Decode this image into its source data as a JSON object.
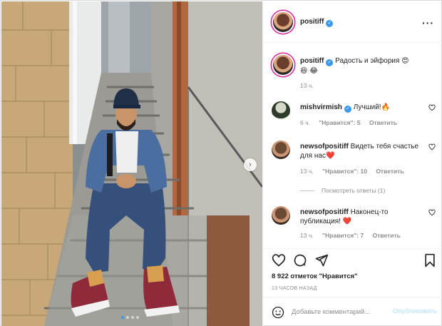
{
  "post": {
    "author": "positiff",
    "verified": true,
    "more_icon": "more-icon"
  },
  "caption": {
    "username": "positiff",
    "text": "Радость и эйфория",
    "emojis": [
      "😍",
      "😆",
      "😂"
    ],
    "time": "13 ч."
  },
  "comments": [
    {
      "username": "mishvirmish",
      "verified": true,
      "text": "Лучший!",
      "emoji": "🔥",
      "time": "6 ч.",
      "likes": "\"Нравится\": 5",
      "reply": "Ответить"
    },
    {
      "username": "newsofpositiff",
      "verified": false,
      "text": "Видеть тебя счастье для нас",
      "emoji": "❤️",
      "time": "13 ч.",
      "likes": "\"Нравится\": 10",
      "reply": "Ответить"
    },
    {
      "username": "newsofpositiff",
      "verified": false,
      "text": "Наконец-то публикация!",
      "emoji": "❤️",
      "time": "13 ч.",
      "likes": "\"Нравится\": 7",
      "reply": "Ответить"
    }
  ],
  "view_replies": "Посмотреть ответы (1)",
  "likes_count": "8 922 отметок \"Нравится\"",
  "posted_time": "13 ЧАСОВ НАЗАД",
  "composer": {
    "placeholder": "Добавьте комментарий...",
    "post_label": "Опубликовать"
  },
  "carousel": {
    "slide_count": 4,
    "active_index": 0
  },
  "colors": {
    "accent": "#3897f0",
    "heart_red": "#ed4956",
    "muted": "#8e8e8e",
    "post_disabled": "#b2dffc"
  }
}
